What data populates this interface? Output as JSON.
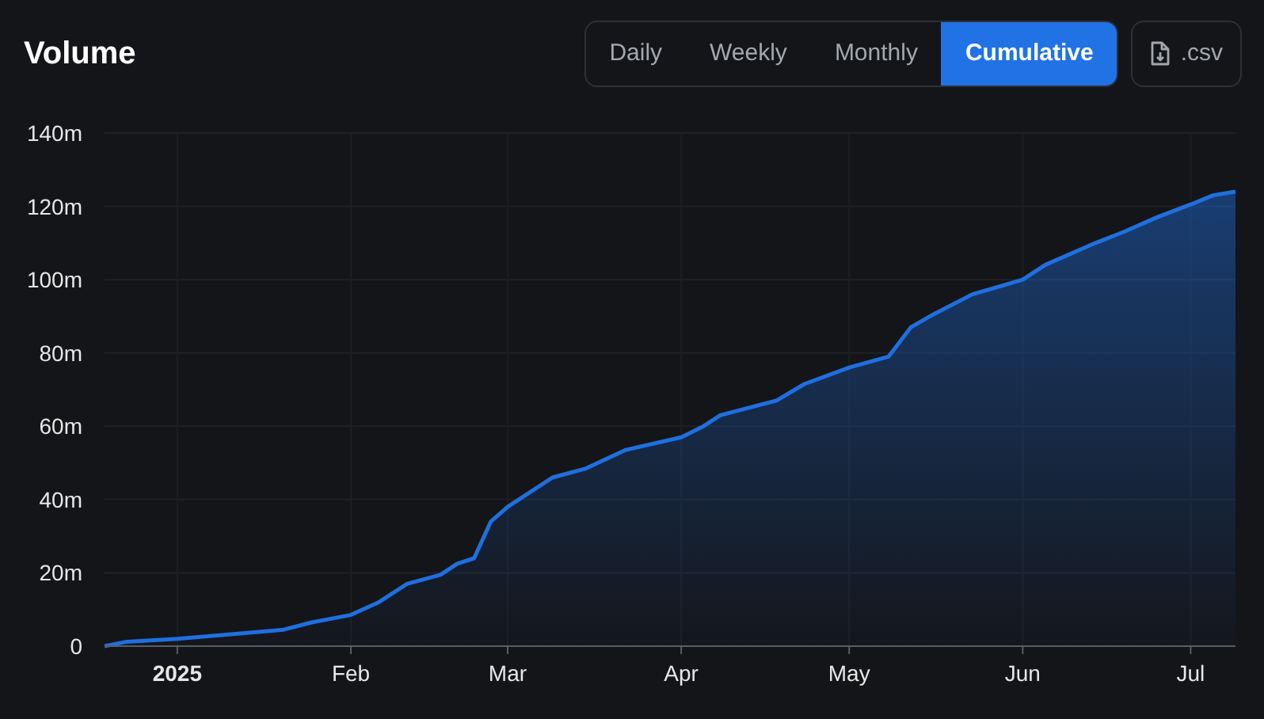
{
  "title": "Volume",
  "tabs": [
    {
      "label": "Daily",
      "selected": false
    },
    {
      "label": "Weekly",
      "selected": false
    },
    {
      "label": "Monthly",
      "selected": false
    },
    {
      "label": "Cumulative",
      "selected": true
    }
  ],
  "download": {
    "label": ".csv"
  },
  "chart_data": {
    "type": "area",
    "x": [
      "2024-12-19",
      "2024-12-23",
      "2025-01-01",
      "2025-01-11",
      "2025-01-20",
      "2025-01-25",
      "2025-02-01",
      "2025-02-06",
      "2025-02-11",
      "2025-02-17",
      "2025-02-20",
      "2025-02-23",
      "2025-02-26",
      "2025-03-01",
      "2025-03-05",
      "2025-03-09",
      "2025-03-15",
      "2025-03-22",
      "2025-04-01",
      "2025-04-05",
      "2025-04-08",
      "2025-04-18",
      "2025-04-23",
      "2025-05-01",
      "2025-05-08",
      "2025-05-12",
      "2025-05-16",
      "2025-05-23",
      "2025-06-01",
      "2025-06-05",
      "2025-06-14",
      "2025-06-19",
      "2025-06-25",
      "2025-07-01",
      "2025-07-05",
      "2025-07-09"
    ],
    "series": [
      {
        "color": "#1f6fe0",
        "values": [
          0,
          1.2,
          2,
          3.3,
          4.5,
          6.5,
          8.5,
          12,
          17,
          19.5,
          22.5,
          24,
          34,
          38,
          42,
          46,
          48.5,
          53.5,
          57,
          60,
          63,
          67,
          71.5,
          76,
          79,
          87,
          90.5,
          96,
          100,
          104,
          110,
          113,
          117,
          120.5,
          123,
          124
        ]
      }
    ],
    "xlim": [
      "2024-12-19",
      "2025-07-09"
    ],
    "ylim": [
      0,
      140
    ],
    "grid": true,
    "xticks": [
      {
        "value": "2025-01-01",
        "label": "2025"
      },
      {
        "value": "2025-02-01",
        "label": "Feb"
      },
      {
        "value": "2025-03-01",
        "label": "Mar"
      },
      {
        "value": "2025-04-01",
        "label": "Apr"
      },
      {
        "value": "2025-05-01",
        "label": "May"
      },
      {
        "value": "2025-06-01",
        "label": "Jun"
      },
      {
        "value": "2025-07-01",
        "label": "Jul"
      }
    ],
    "yticks": [
      {
        "value": 0,
        "label": "0"
      },
      {
        "value": 20,
        "label": "20m"
      },
      {
        "value": 40,
        "label": "40m"
      },
      {
        "value": 60,
        "label": "60m"
      },
      {
        "value": 80,
        "label": "80m"
      },
      {
        "value": 100,
        "label": "100m"
      },
      {
        "value": 120,
        "label": "120m"
      },
      {
        "value": 140,
        "label": "140m"
      }
    ]
  }
}
